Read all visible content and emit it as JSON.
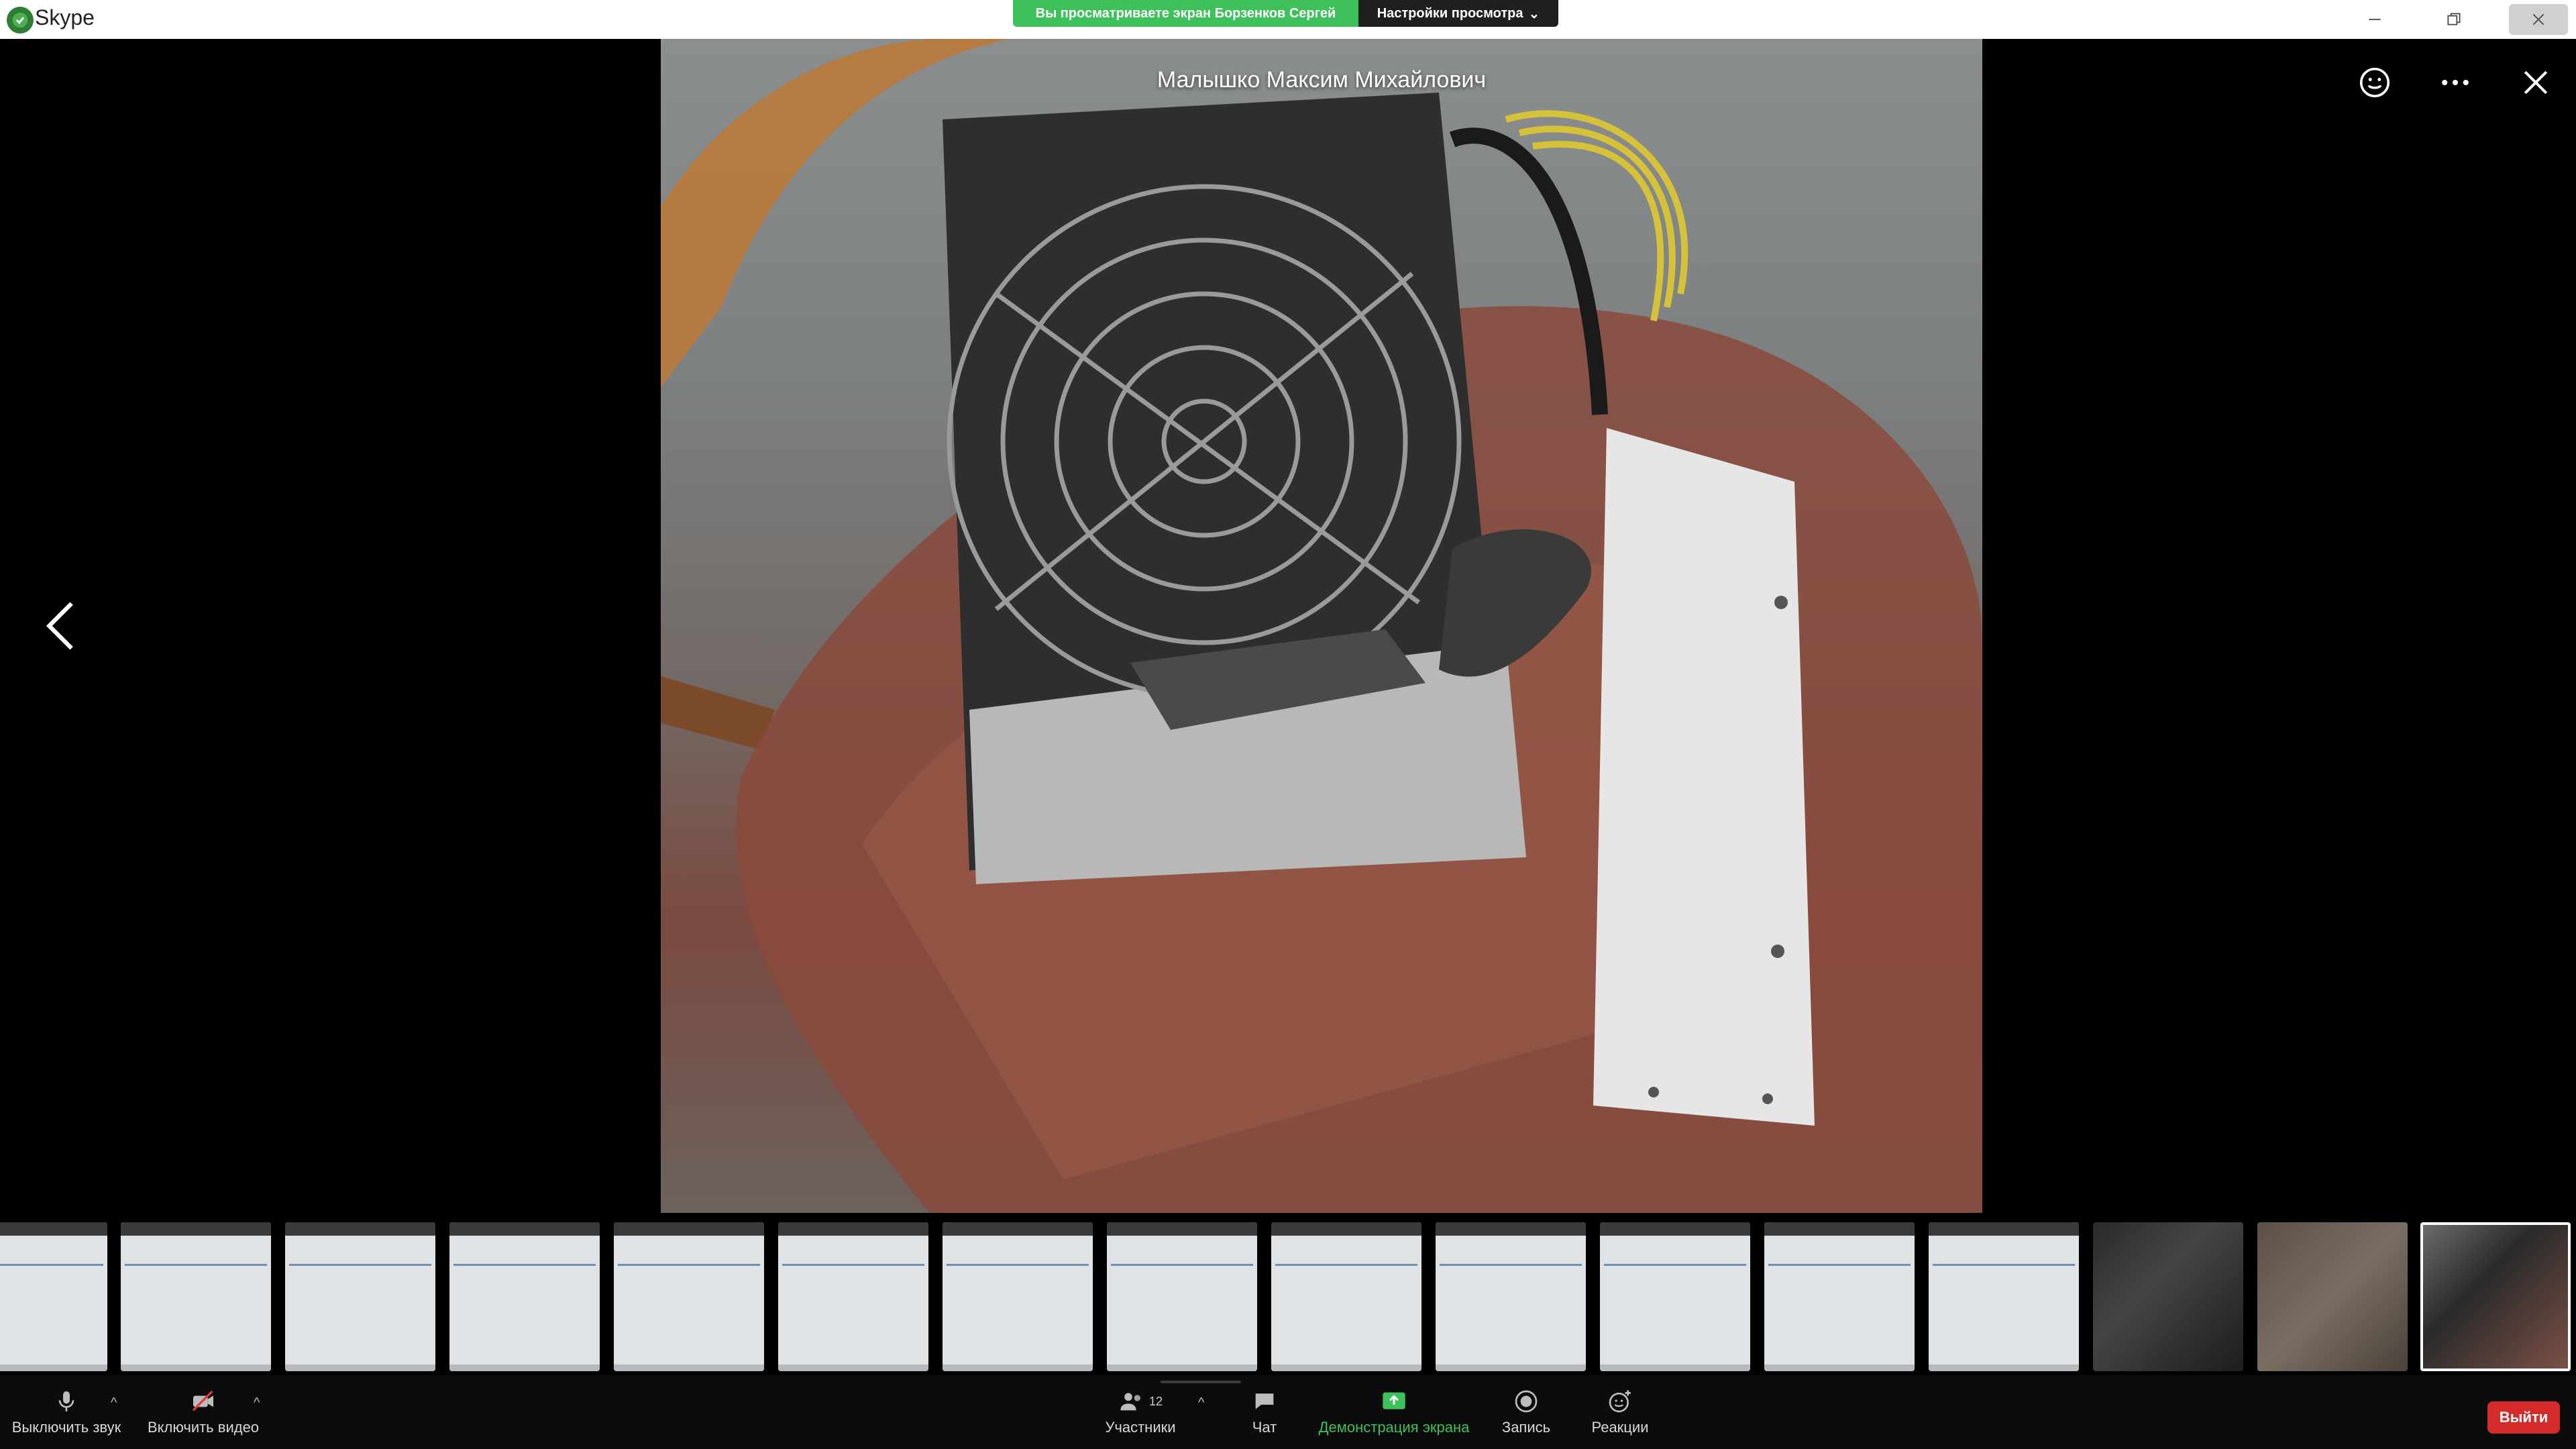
{
  "titlebar": {
    "app_title": "Skype",
    "share_banner": "Вы просматриваете экран Борзенков Сергей",
    "view_settings": "Настройки просмотра"
  },
  "video": {
    "presenter_name": "Малышко Максим Михайлович"
  },
  "thumbnails": [
    {
      "kind": "screen"
    },
    {
      "kind": "screen"
    },
    {
      "kind": "screen"
    },
    {
      "kind": "screen"
    },
    {
      "kind": "screen"
    },
    {
      "kind": "screen"
    },
    {
      "kind": "screen"
    },
    {
      "kind": "screen"
    },
    {
      "kind": "screen"
    },
    {
      "kind": "screen"
    },
    {
      "kind": "screen"
    },
    {
      "kind": "screen"
    },
    {
      "kind": "screen"
    },
    {
      "kind": "photo-keyboard"
    },
    {
      "kind": "photo-cable"
    },
    {
      "kind": "photo-psu",
      "selected": true
    }
  ],
  "toolbar": {
    "mute_label": "Выключить звук",
    "video_label": "Включить видео",
    "participants_label": "Участники",
    "participants_count": "12",
    "chat_label": "Чат",
    "share_label": "Демонстрация экрана",
    "record_label": "Запись",
    "reactions_label": "Реакции",
    "leave_label": "Выйти"
  },
  "colors": {
    "share_green": "#3ec15a",
    "leave_red": "#d42b2b"
  }
}
